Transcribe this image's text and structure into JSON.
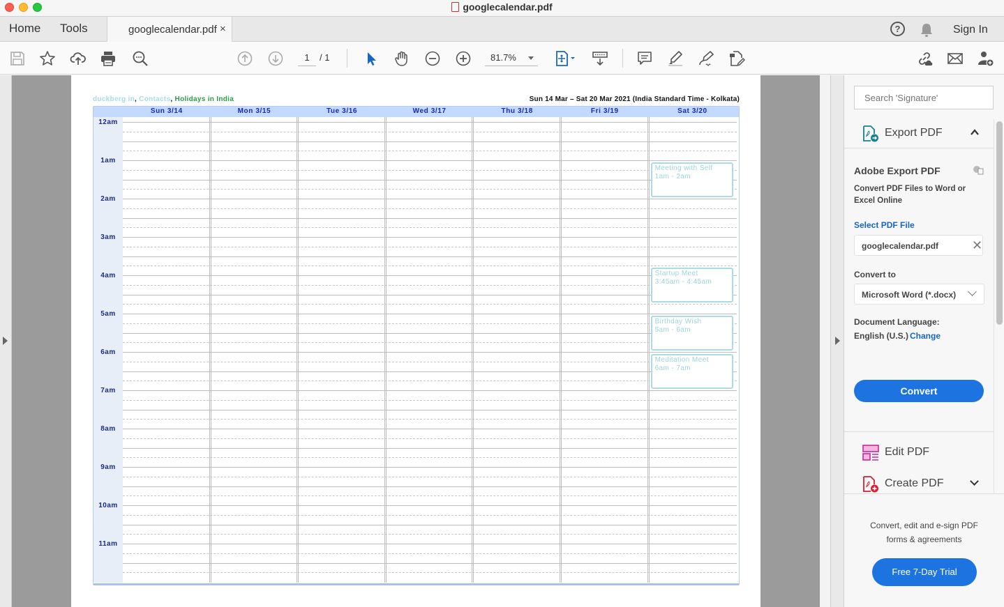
{
  "window": {
    "title": "googlecalendar.pdf",
    "traffic_lights": [
      "close",
      "minimize",
      "maximize"
    ]
  },
  "tabbar": {
    "home_label": "Home",
    "tools_label": "Tools",
    "document_tab": "googlecalendar.pdf",
    "document_tab_close": "×",
    "help_icon": "?",
    "sign_in": "Sign In"
  },
  "toolbar": {
    "left_icons": [
      "save-icon",
      "bookmark-star-icon",
      "upload-cloud-icon",
      "print-icon",
      "search-zoom-icon"
    ],
    "page_current": "1",
    "page_total": "/ 1",
    "zoom_value": "81.7%",
    "tool_icons": [
      "select-arrow-icon",
      "hand-icon",
      "zoom-out-icon",
      "zoom-in-icon",
      "fit-page-icon",
      "scroll-mode-icon",
      "comment-icon",
      "highlight-icon",
      "sign-icon",
      "edit-icon"
    ],
    "right_icons": [
      "share-link-icon",
      "email-icon",
      "add-user-icon"
    ]
  },
  "calendar": {
    "sources": [
      {
        "name": "duckberg in",
        "color": "#a6dde4"
      },
      {
        "name": "Contacts",
        "color": "#a6dde4"
      },
      {
        "name": "Holidays in India",
        "color": "#2a9d4c"
      }
    ],
    "separator": ",",
    "range": "Sun 14 Mar – Sat 20 Mar 2021 (India Standard Time - Kolkata)",
    "days": [
      "Sun 3/14",
      "Mon 3/15",
      "Tue 3/16",
      "Wed 3/17",
      "Thu 3/18",
      "Fri 3/19",
      "Sat 3/20"
    ],
    "hours": [
      "12am",
      "1am",
      "2am",
      "3am",
      "4am",
      "5am",
      "6am",
      "7am",
      "8am",
      "9am",
      "10am",
      "11am"
    ],
    "events": [
      {
        "title": "Meeting with Self",
        "time": "1am - 2am",
        "day": 6,
        "start": 1.0,
        "end": 2.0
      },
      {
        "title": "Startup Meet",
        "time": "3:45am - 4:45am",
        "day": 6,
        "start": 3.75,
        "end": 4.75
      },
      {
        "title": "Birthday Wish",
        "time": "5am - 6am",
        "day": 6,
        "start": 5.0,
        "end": 6.0
      },
      {
        "title": "Meditation Meet",
        "time": "6am - 7am",
        "day": 6,
        "start": 6.0,
        "end": 7.0
      }
    ]
  },
  "panel": {
    "search_placeholder": "Search 'Signature'",
    "export_pdf_label": "Export PDF",
    "adobe_export_title": "Adobe Export PDF",
    "adobe_export_desc": "Convert PDF Files to Word or Excel Online",
    "select_file_label": "Select PDF File",
    "selected_file": "googlecalendar.pdf",
    "convert_to_label": "Convert to",
    "convert_to_value": "Microsoft Word (*.docx)",
    "doc_language_label": "Document Language:",
    "doc_language_value": "English (U.S.)",
    "change_link": "Change",
    "convert_button": "Convert",
    "edit_pdf_label": "Edit PDF",
    "create_pdf_label": "Create PDF",
    "promo_text": "Convert, edit and e-sign PDF forms & agreements",
    "trial_button": "Free 7-Day Trial"
  },
  "colors": {
    "accent_blue": "#1d74e0",
    "link_blue": "#1666c5",
    "export_teal": "#17838e",
    "edit_magenta": "#c5289a",
    "create_red": "#d1223a",
    "calendar_header": "#c3d9ff",
    "event_border": "#a9dde3"
  }
}
